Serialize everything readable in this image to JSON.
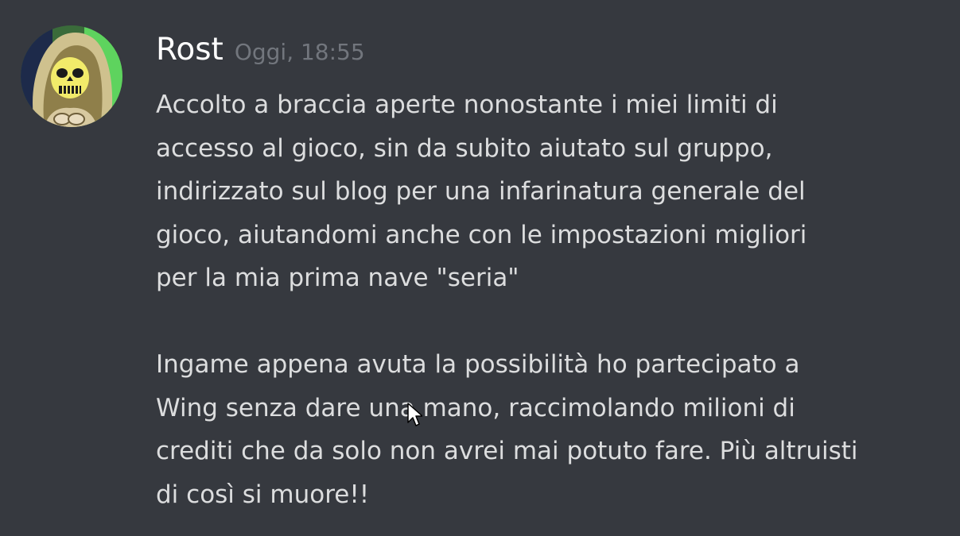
{
  "message": {
    "author": "Rost",
    "timestamp": "Oggi, 18:55",
    "avatar_icon": "skeletor-avatar-icon",
    "paragraph1": [
      "Accolto a braccia aperte nonostante i miei limiti di",
      "accesso al gioco, sin da subito aiutato sul gruppo,",
      "indirizzato sul blog per una infarinatura generale del",
      "gioco, aiutandomi anche con le impostazioni migliori",
      "per la mia prima nave \"seria\""
    ],
    "paragraph2": [
      "Ingame appena avuta la possibilità ho partecipato a",
      "Wing senza dare una mano, raccimolando milioni di",
      "crediti che da solo non avrei mai potuto fare. Più altruisti",
      "di così si muore!!"
    ]
  },
  "colors": {
    "background": "#36393f",
    "username": "#ffffff",
    "timestamp": "#72767d",
    "text": "#dcddde"
  }
}
